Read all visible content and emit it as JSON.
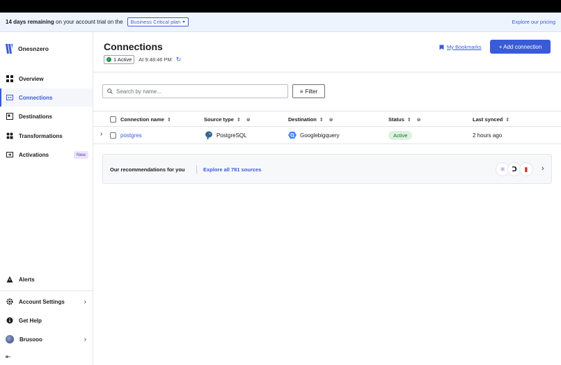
{
  "trial": {
    "days_remaining": "14 days remaining",
    "rest": " on your account trial on the",
    "plan": "Business Critical plan",
    "pricing_link": "Explore our pricing"
  },
  "sidebar": {
    "workspace": "Onesnzero",
    "items": [
      {
        "label": "Overview",
        "icon": "overview-grid-icon"
      },
      {
        "label": "Connections",
        "icon": "connections-icon"
      },
      {
        "label": "Destinations",
        "icon": "destinations-icon"
      },
      {
        "label": "Transformations",
        "icon": "transformations-icon"
      },
      {
        "label": "Activations",
        "icon": "activations-icon",
        "badge": "New"
      }
    ],
    "bottom": {
      "alerts": "Alerts",
      "account_settings": "Account Settings",
      "get_help": "Get Help",
      "user": "Brusooo"
    }
  },
  "main": {
    "title": "Connections",
    "active_pill": "1 Active",
    "at_time": "At 9:48:46 PM",
    "bookmarks": "My Bookmarks",
    "add_button": "+ Add connection",
    "search_placeholder": "Search by name...",
    "filter": "Filter",
    "columns": [
      "Connection name",
      "Source type",
      "Destination",
      "Status",
      "Last synced"
    ],
    "row": {
      "name": "postgres",
      "source_type": "PostgreSQL",
      "destination": "Googlebigquery",
      "status": "Active",
      "last_synced": "2 hours ago"
    },
    "reco": {
      "title": "Our recommendations for you",
      "link": "Explore all 781 sources"
    }
  },
  "colors": {
    "accent": "#3a5bd8",
    "status_active_bg": "#dcf2df",
    "badge_new_bg": "#ece4fb"
  }
}
